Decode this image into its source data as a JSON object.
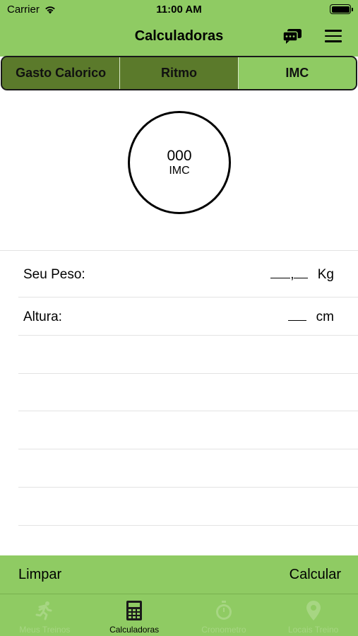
{
  "status": {
    "carrier": "Carrier",
    "time": "11:00 AM"
  },
  "nav": {
    "title": "Calculadoras"
  },
  "segments": [
    "Gasto Calorico",
    "Ritmo",
    "IMC"
  ],
  "result": {
    "value": "000",
    "label": "IMC"
  },
  "form": {
    "weight": {
      "label": "Seu Peso:",
      "unit": "Kg",
      "separator": ","
    },
    "height": {
      "label": "Altura:",
      "unit": "cm"
    }
  },
  "actions": {
    "clear": "Limpar",
    "calculate": "Calcular"
  },
  "tabs": [
    {
      "label": "Meus Treinos",
      "icon": "runner-icon"
    },
    {
      "label": "Calculadoras",
      "icon": "calculator-icon"
    },
    {
      "label": "Cronometro",
      "icon": "stopwatch-icon"
    },
    {
      "label": "Locais Treino",
      "icon": "location-pin-icon"
    }
  ],
  "colors": {
    "accent": "#8fcb63",
    "segment_dark": "#5b7a2b",
    "tab_inactive": "#a7d683"
  }
}
